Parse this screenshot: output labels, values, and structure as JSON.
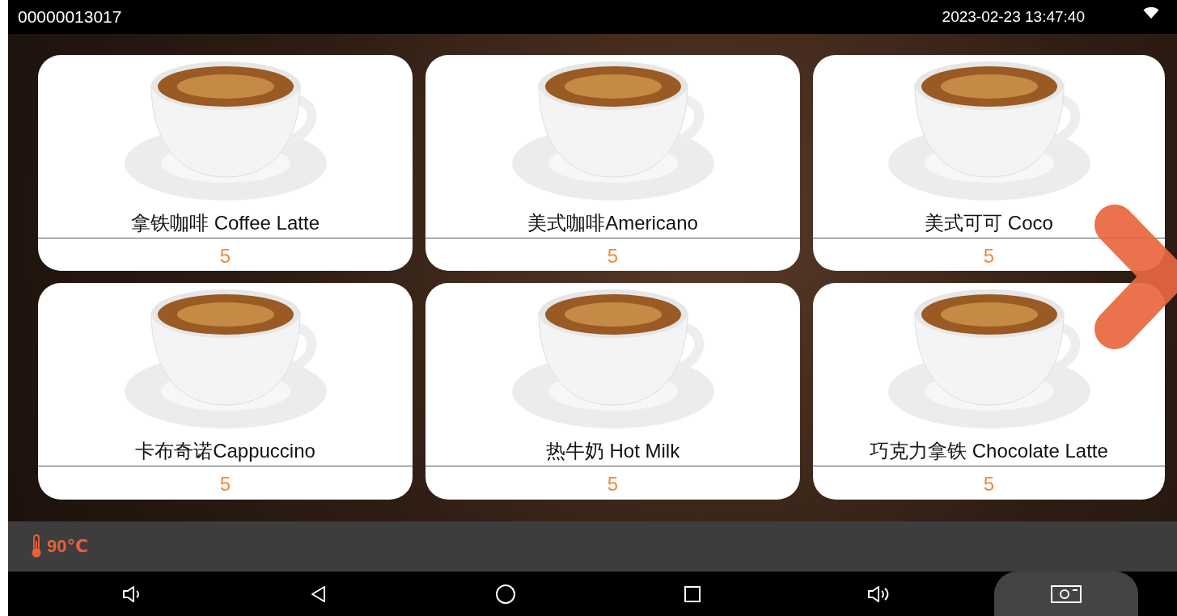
{
  "status_bar": {
    "device_id": "00000013017",
    "datetime": "2023-02-23 13:47:40"
  },
  "products": [
    {
      "name": "拿铁咖啡 Coffee Latte",
      "price": "5"
    },
    {
      "name": "美式咖啡Americano",
      "price": "5"
    },
    {
      "name": "美式可可 Coco",
      "price": "5"
    },
    {
      "name": "卡布奇诺Cappuccino",
      "price": "5"
    },
    {
      "name": "热牛奶 Hot Milk",
      "price": "5"
    },
    {
      "name": "巧克力拿铁 Chocolate Latte",
      "price": "5"
    }
  ],
  "temperature": {
    "reading": "90℃"
  }
}
